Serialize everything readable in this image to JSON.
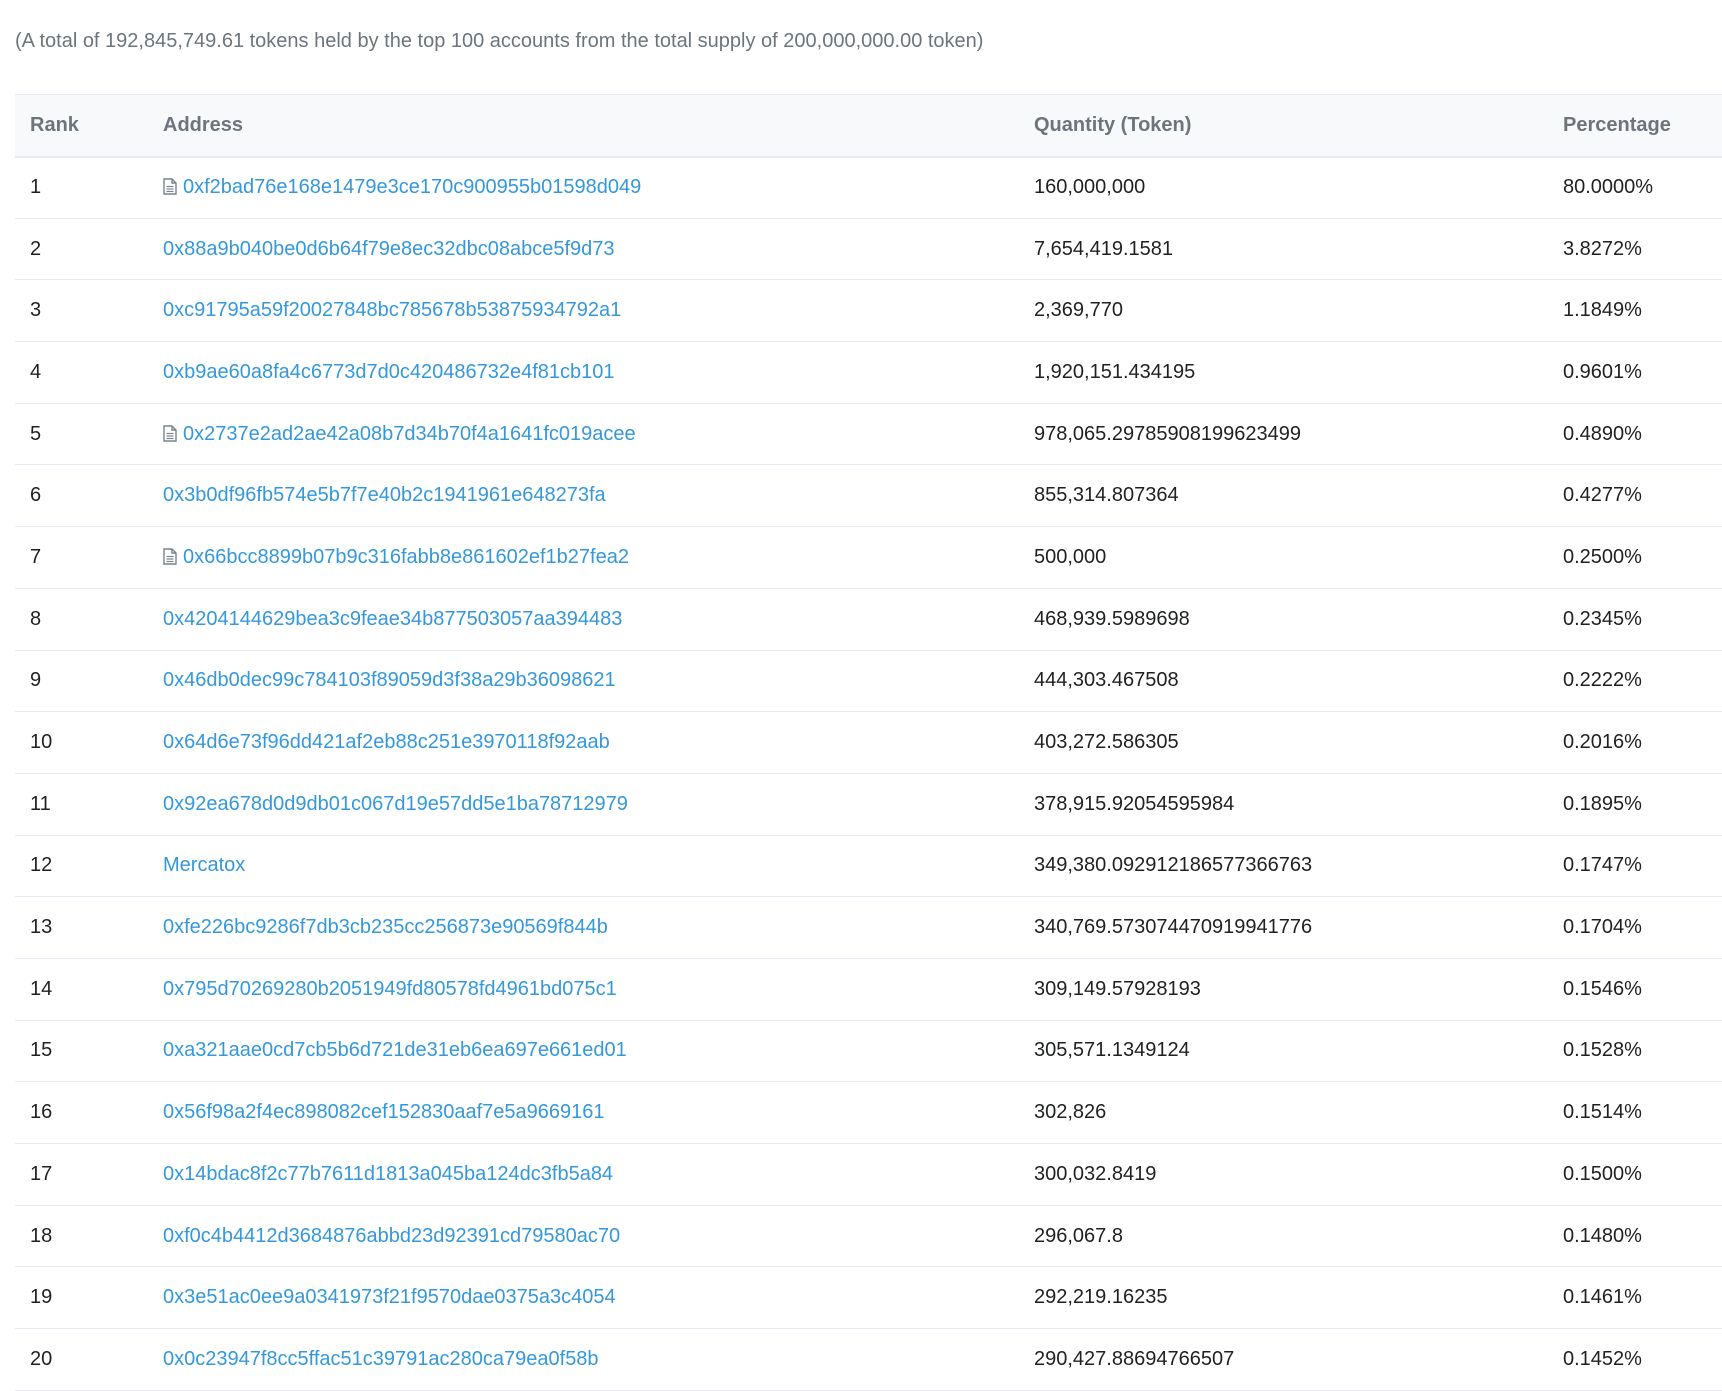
{
  "summary_text": "(A total of 192,845,749.61 tokens held by the top 100 accounts from the total supply of 200,000,000.00 token)",
  "table": {
    "headers": {
      "rank": "Rank",
      "address": "Address",
      "quantity": "Quantity (Token)",
      "percentage": "Percentage"
    },
    "rows": [
      {
        "rank": "1",
        "address": "0xf2bad76e168e1479e3ce170c900955b01598d049",
        "contract": true,
        "quantity": "160,000,000",
        "percentage": "80.0000%"
      },
      {
        "rank": "2",
        "address": "0x88a9b040be0d6b64f79e8ec32dbc08abce5f9d73",
        "contract": false,
        "quantity": "7,654,419.1581",
        "percentage": "3.8272%"
      },
      {
        "rank": "3",
        "address": "0xc91795a59f20027848bc785678b53875934792a1",
        "contract": false,
        "quantity": "2,369,770",
        "percentage": "1.1849%"
      },
      {
        "rank": "4",
        "address": "0xb9ae60a8fa4c6773d7d0c420486732e4f81cb101",
        "contract": false,
        "quantity": "1,920,151.434195",
        "percentage": "0.9601%"
      },
      {
        "rank": "5",
        "address": "0x2737e2ad2ae42a08b7d34b70f4a1641fc019acee",
        "contract": true,
        "quantity": "978,065.29785908199623499",
        "percentage": "0.4890%"
      },
      {
        "rank": "6",
        "address": "0x3b0df96fb574e5b7f7e40b2c1941961e648273fa",
        "contract": false,
        "quantity": "855,314.807364",
        "percentage": "0.4277%"
      },
      {
        "rank": "7",
        "address": "0x66bcc8899b07b9c316fabb8e861602ef1b27fea2",
        "contract": true,
        "quantity": "500,000",
        "percentage": "0.2500%"
      },
      {
        "rank": "8",
        "address": "0x4204144629bea3c9feae34b877503057aa394483",
        "contract": false,
        "quantity": "468,939.5989698",
        "percentage": "0.2345%"
      },
      {
        "rank": "9",
        "address": "0x46db0dec99c784103f89059d3f38a29b36098621",
        "contract": false,
        "quantity": "444,303.467508",
        "percentage": "0.2222%"
      },
      {
        "rank": "10",
        "address": "0x64d6e73f96dd421af2eb88c251e3970118f92aab",
        "contract": false,
        "quantity": "403,272.586305",
        "percentage": "0.2016%"
      },
      {
        "rank": "11",
        "address": "0x92ea678d0d9db01c067d19e57dd5e1ba78712979",
        "contract": false,
        "quantity": "378,915.92054595984",
        "percentage": "0.1895%"
      },
      {
        "rank": "12",
        "address": "Mercatox",
        "contract": false,
        "quantity": "349,380.092912186577366763",
        "percentage": "0.1747%"
      },
      {
        "rank": "13",
        "address": "0xfe226bc9286f7db3cb235cc256873e90569f844b",
        "contract": false,
        "quantity": "340,769.573074470919941776",
        "percentage": "0.1704%"
      },
      {
        "rank": "14",
        "address": "0x795d70269280b2051949fd80578fd4961bd075c1",
        "contract": false,
        "quantity": "309,149.57928193",
        "percentage": "0.1546%"
      },
      {
        "rank": "15",
        "address": "0xa321aae0cd7cb5b6d721de31eb6ea697e661ed01",
        "contract": false,
        "quantity": "305,571.1349124",
        "percentage": "0.1528%"
      },
      {
        "rank": "16",
        "address": "0x56f98a2f4ec898082cef152830aaf7e5a9669161",
        "contract": false,
        "quantity": "302,826",
        "percentage": "0.1514%"
      },
      {
        "rank": "17",
        "address": "0x14bdac8f2c77b7611d1813a045ba124dc3fb5a84",
        "contract": false,
        "quantity": "300,032.8419",
        "percentage": "0.1500%"
      },
      {
        "rank": "18",
        "address": "0xf0c4b4412d3684876abbd23d92391cd79580ac70",
        "contract": false,
        "quantity": "296,067.8",
        "percentage": "0.1480%"
      },
      {
        "rank": "19",
        "address": "0x3e51ac0ee9a0341973f21f9570dae0375a3c4054",
        "contract": false,
        "quantity": "292,219.16235",
        "percentage": "0.1461%"
      },
      {
        "rank": "20",
        "address": "0x0c23947f8cc5ffac51c39791ac280ca79ea0f58b",
        "contract": false,
        "quantity": "290,427.88694766507",
        "percentage": "0.1452%"
      }
    ]
  },
  "icons": {
    "contract": "contract-file-icon"
  },
  "colors": {
    "link": "#3498db",
    "header_text": "#6c757e",
    "header_bg": "#f8f9fa",
    "border": "#e7eaf3"
  }
}
